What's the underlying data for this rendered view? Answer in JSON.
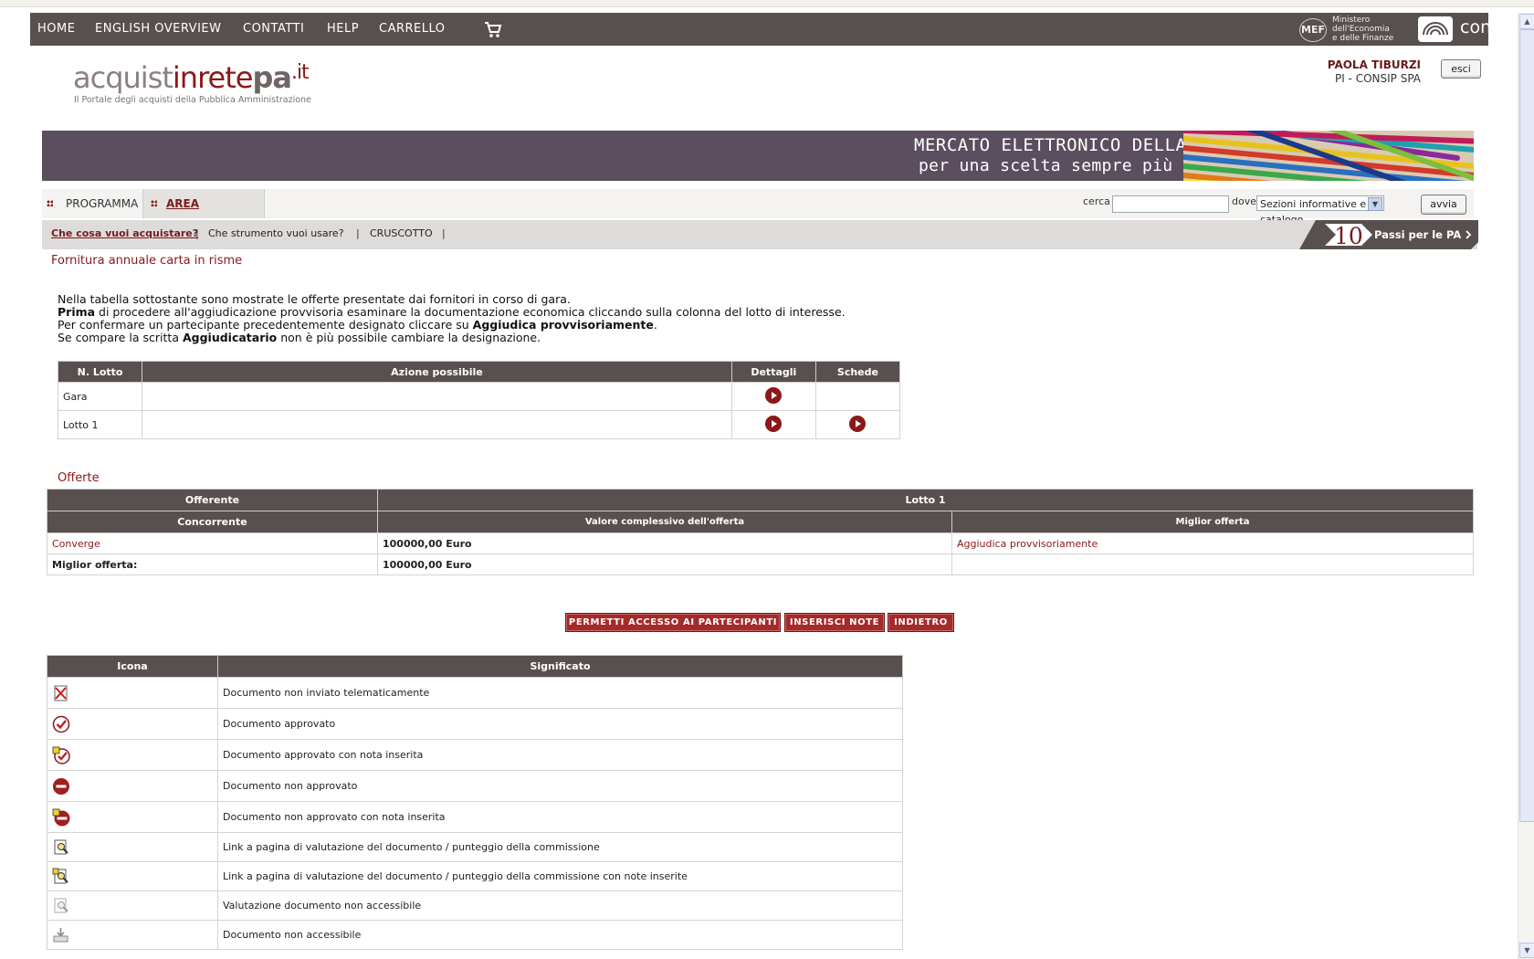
{
  "topnav": {
    "items": [
      "HOME",
      "ENGLISH OVERVIEW",
      "CONTATTI",
      "HELP",
      "CARRELLO"
    ],
    "mef_logo": "MEF",
    "mef_lines": [
      "Ministero",
      "dell'Economia",
      "e delle Finanze"
    ],
    "consip": "consip"
  },
  "logo": {
    "part1": "acquist",
    "part2": "inrete",
    "part3": "pa",
    "part4": ".it",
    "subtitle": "Il Portale degli acquisti della Pubblica Amministrazione"
  },
  "user": {
    "name": "PAOLA TIBURZI",
    "org": "PI - CONSIP SPA",
    "logout": "esci"
  },
  "banner": {
    "line1": "MERCATO ELETTRONICO DELLA P.A.",
    "line2": "per una scelta sempre più ampia!"
  },
  "tabs": {
    "programma": "PROGRAMMA",
    "area_personale": "AREA PERSONALE"
  },
  "search": {
    "label": "cerca",
    "where_label": "dove",
    "select_value": "Sezioni informative e catalogo",
    "button": "avvia"
  },
  "subnav": {
    "items": [
      "Che cosa vuoi acquistare?",
      "Che strumento vuoi usare?",
      "CRUSCOTTO"
    ],
    "passi_number": "10",
    "passi_text": "Passi per le PA"
  },
  "page": {
    "title": "Fornitura annuale carta in risme"
  },
  "intro": {
    "line1": "Nella tabella sottostante sono mostrate le offerte presentate dai fornitori in corso di gara.",
    "line2_bold": "Prima",
    "line2_rest": " di procedere all'aggiudicazione provvisoria esaminare la documentazione economica cliccando sulla colonna del lotto di interesse.",
    "line3_pre": "Per confermare un partecipante precedentemente designato cliccare su ",
    "line3_bold": "Aggiudica provvisoriamente",
    "line3_post": ".",
    "line4_pre": "Se compare la scritta ",
    "line4_bold": "Aggiudicatario",
    "line4_post": " non è più possibile cambiare la designazione."
  },
  "lotti_table": {
    "headers": [
      "N. Lotto",
      "Azione possibile",
      "Dettagli",
      "Schede"
    ],
    "rows": [
      {
        "lotto": "Gara",
        "azione": ""
      },
      {
        "lotto": "Lotto 1",
        "azione": ""
      }
    ]
  },
  "offerte": {
    "title": "Offerte",
    "header_offerente": "Offerente",
    "header_lotto": "Lotto 1",
    "header_concorrente": "Concorrente",
    "header_valore": "Valore complessivo dell'offerta",
    "header_migliore": "Miglior offerta",
    "row_name": "Converge",
    "row_valore": "100000,00 Euro",
    "row_action": "Aggiudica provvisoriamente",
    "best_label": "Miglior offerta:",
    "best_valore": "100000,00 Euro"
  },
  "buttons": {
    "permetti": "PERMETTI ACCESSO AI PARTECIPANTI",
    "note": "INSERISCI NOTE",
    "indietro": "INDIETRO"
  },
  "legend": {
    "headers": [
      "Icona",
      "Significato"
    ],
    "rows": [
      {
        "icon": "document-not-sent-icon",
        "text": "Documento non inviato telematicamente"
      },
      {
        "icon": "approved-icon",
        "text": "Documento approvato"
      },
      {
        "icon": "approved-note-icon",
        "text": "Documento approvato con nota inserita"
      },
      {
        "icon": "not-approved-icon",
        "text": "Documento non approvato"
      },
      {
        "icon": "not-approved-note-icon",
        "text": "Documento non approvato con nota inserita"
      },
      {
        "icon": "evaluation-link-icon",
        "text": "Link a pagina di valutazione del documento / punteggio della commissione"
      },
      {
        "icon": "evaluation-link-note-icon",
        "text": "Link a pagina di valutazione del documento / punteggio della commissione con note inserite"
      },
      {
        "icon": "evaluation-disabled-icon",
        "text": "Valutazione documento non accessibile"
      },
      {
        "icon": "document-inaccessible-icon",
        "text": "Documento non accessibile"
      }
    ]
  },
  "colors": {
    "nav": "#58504f",
    "accent": "#8b1818",
    "banner": "#5b4e5e"
  }
}
